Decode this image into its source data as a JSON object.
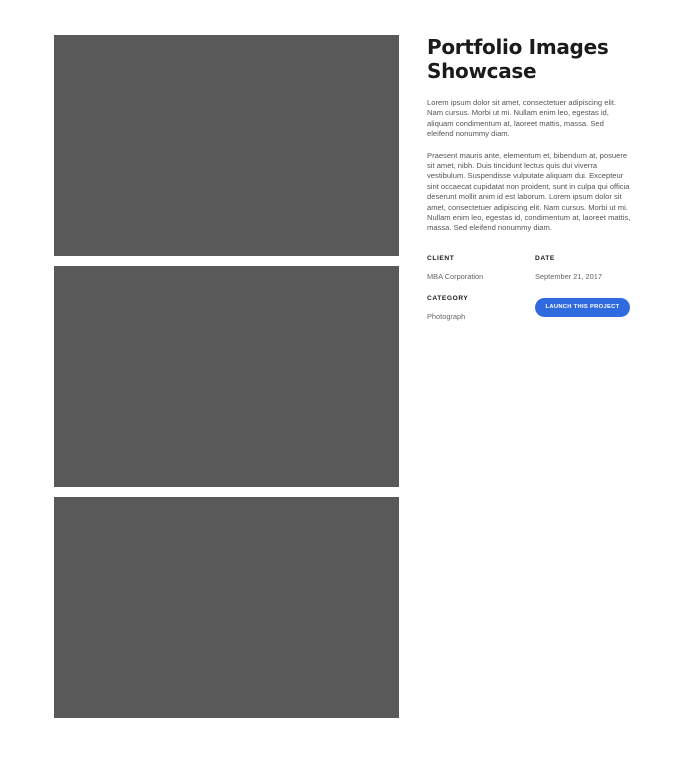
{
  "project": {
    "title": "Portfolio Images Showcase",
    "paragraphs": [
      "Lorem ipsum dolor sit amet, consectetuer adipiscing elit. Nam cursus. Morbi ut mi. Nullam enim leo, egestas id, aliquam condimentum at, laoreet mattis, massa. Sed eleifend nonummy diam.",
      "Praesent mauris ante, elementum et, bibendum at, posuere sit amet, nibh. Duis tincidunt lectus quis dui viverra vestibulum. Suspendisse vulputate aliquam dui. Excepteur sint occaecat cupidatat non proident, sunt in culpa qui officia deserunt mollit anim id est laborum. Lorem ipsum dolor sit amet, consectetuer adipiscing elit. Nam cursus. Morbi ut mi. Nullam enim leo, egestas id, condimentum at, laoreet mattis, massa. Sed eleifend nonummy diam."
    ]
  },
  "meta": {
    "client_label": "CLIENT",
    "client_value": "MBA Corporation",
    "date_label": "DATE",
    "date_value": "September 21, 2017",
    "category_label": "CATEGORY",
    "category_value": "Photograph"
  },
  "actions": {
    "launch_label": "LAUNCH THIS PROJECT"
  },
  "gallery": {
    "image_count": 3,
    "placeholder_color": "#595959"
  },
  "colors": {
    "accent": "#2f6bdf",
    "heading": "#1b1b1b",
    "body_text": "#555555"
  }
}
